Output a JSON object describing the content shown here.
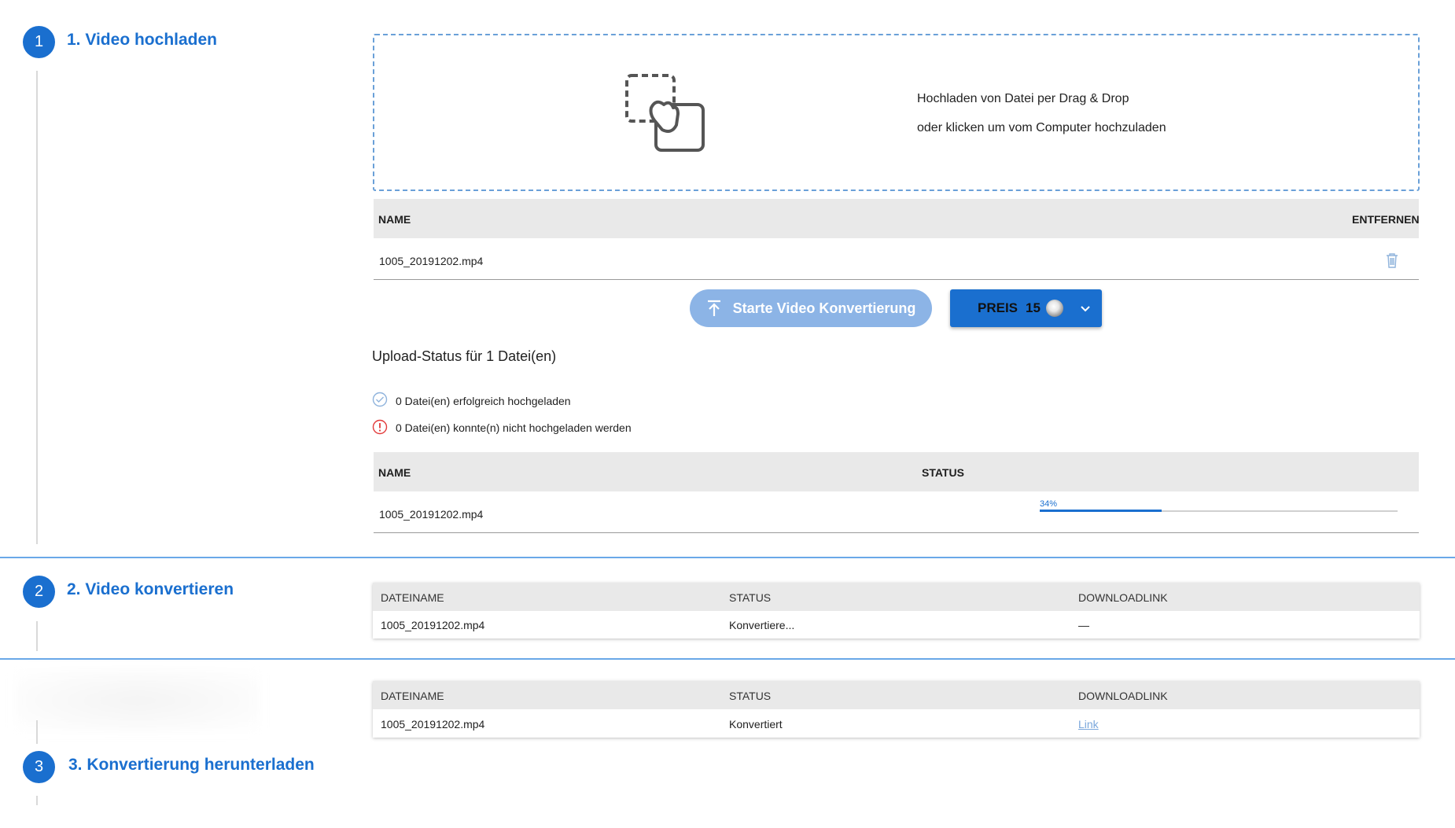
{
  "steps": [
    {
      "number": "1",
      "title": "1. Video hochladen"
    },
    {
      "number": "2",
      "title": "2. Video konvertieren"
    },
    {
      "number": "3",
      "title": "3. Konvertierung herunterladen"
    }
  ],
  "dropzone": {
    "line1": "Hochladen von Datei per Drag & Drop",
    "line2": "oder klicken um vom Computer hochzuladen",
    "icon": "drag-drop-icon"
  },
  "file_table": {
    "col_name": "NAME",
    "col_remove": "ENTFERNEN",
    "rows": [
      {
        "name": "1005_20191202.mp4",
        "remove_icon": "trash-icon"
      }
    ]
  },
  "actions": {
    "start_label": "Starte Video Konvertierung",
    "start_icon": "upload-arrow-icon",
    "price_label": "PREIS",
    "price_value": "15",
    "price_icon": "coin-icon",
    "dropdown_icon": "chevron-down-icon"
  },
  "upload_status": {
    "heading": "Upload-Status für 1 Datei(en)",
    "success_text": "0 Datei(en) erfolgreich hochgeladen",
    "error_text": "0 Datei(en) konnte(n) nicht hochgeladen werden",
    "col_name": "NAME",
    "col_status": "STATUS",
    "rows": [
      {
        "name": "1005_20191202.mp4",
        "progress_label": "34%",
        "progress": 0.34
      }
    ]
  },
  "convert_table": {
    "col_file": "DATEINAME",
    "col_status": "STATUS",
    "col_link": "DOWNLOADLINK",
    "rows": [
      {
        "file": "1005_20191202.mp4",
        "status": "Konvertiere...",
        "link": "—"
      }
    ]
  },
  "download_table": {
    "col_file": "DATEINAME",
    "col_status": "STATUS",
    "col_link": "DOWNLOADLINK",
    "rows": [
      {
        "file": "1005_20191202.mp4",
        "status": "Konvertiert",
        "link": "Link"
      }
    ]
  },
  "colors": {
    "accent": "#1a6fcf",
    "button_light": "#8cb4e6",
    "separator": "#6aa8e8",
    "error": "#e23b3b"
  }
}
